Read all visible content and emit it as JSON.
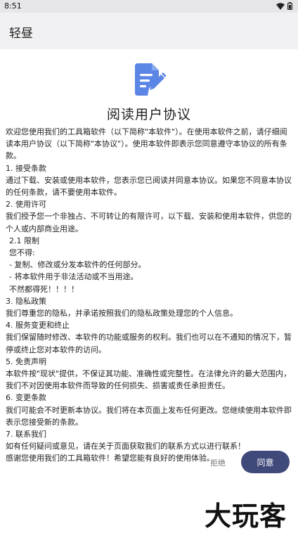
{
  "status_bar": {
    "time": "8:51",
    "wifi_icon": "wifi-icon",
    "battery_icon": "battery-icon"
  },
  "app_bar": {
    "title": "轻昼"
  },
  "dialog": {
    "icon": "document-edit-icon",
    "accent_color": "#5b86e5",
    "title": "阅读用户协议",
    "paragraphs": [
      {
        "text": "欢迎您使用我们的工具箱软件（以下简称\"本软件\"）。在使用本软件之前，请仔细阅读本用户协议（以下简称\"本协议\"）。使用本软件即表示您同意遵守本协议的所有条款。",
        "indent": false
      },
      {
        "text": "1. 接受条款",
        "indent": false
      },
      {
        "text": "通过下载、安装或使用本软件，您表示您已阅读并同意本协议。如果您不同意本协议的任何条款，请不要使用本软件。",
        "indent": false
      },
      {
        "text": "2. 使用许可",
        "indent": false
      },
      {
        "text": "我们授予您一个非独占、不可转让的有限许可，以下载、安装和使用本软件，供您的个人或内部商业用途。",
        "indent": false
      },
      {
        "text": "2.1 限制",
        "indent": true
      },
      {
        "text": "您不得:",
        "indent": true
      },
      {
        "text": "- 复制、修改或分发本软件的任何部分。",
        "indent": true
      },
      {
        "text": "- 将本软件用于非法活动或不当用途。",
        "indent": true
      },
      {
        "text": "不然都得死！！！！",
        "indent": true
      },
      {
        "text": "3. 隐私政策",
        "indent": false
      },
      {
        "text": "我们尊重您的隐私，并承诺按照我们的隐私政策处理您的个人信息。",
        "indent": false
      },
      {
        "text": "4. 服务变更和终止",
        "indent": false
      },
      {
        "text": "我们保留随时修改、本软件的功能或服务的权利。我们也可以在不通知的情况下，暂停或终止您对本软件的访问。",
        "indent": false
      },
      {
        "text": "5. 免责声明",
        "indent": false
      },
      {
        "text": "本软件按\"现状\"提供，不保证其功能、准确性或完整性。在法律允许的最大范围内，我们不对因使用本软件而导致的任何损失、损害或责任承担责任。",
        "indent": false
      },
      {
        "text": "6. 变更条款",
        "indent": false
      },
      {
        "text": "我们可能会不时更新本协议。我们将在本页面上发布任何更改。您继续使用本软件即表示您接受新的条款。",
        "indent": false
      },
      {
        "text": "7. 联系我们",
        "indent": false
      },
      {
        "text": "如有任何疑问或意见，请在关于页面获取我们的联系方式以进行联系！",
        "indent": false
      },
      {
        "text": "感谢您使用我们的工具箱软件！希望您能有良好的使用体验。",
        "indent": false
      }
    ],
    "reject_label": "拒绝",
    "agree_label": "同意",
    "agree_color": "#3f4a7a"
  },
  "watermark": {
    "text": "大玩客"
  }
}
